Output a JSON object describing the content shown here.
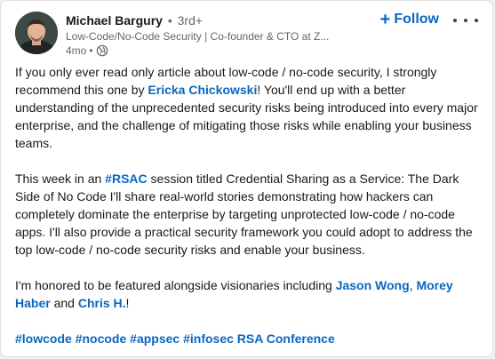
{
  "post": {
    "author": {
      "name": "Michael Bargury",
      "separator": "•",
      "degree": "3rd+",
      "headline": "Low-Code/No-Code Security | Co-founder & CTO at Z...",
      "age": "4mo",
      "meta_dot": "•"
    },
    "follow_label": "Follow",
    "follow_plus": "+",
    "paragraph1": {
      "t1": "If you only ever read only article about low-code / no-code security, I strongly recommend this one by ",
      "mention": "Ericka Chickowski",
      "t2": "! You'll end up with a better understanding of the unprecedented security risks being introduced into every major enterprise, and the challenge of mitigating those risks while enabling your business teams."
    },
    "paragraph2": {
      "t1": "This week in an ",
      "hashtag": "#RSAC",
      "t2": " session titled Credential Sharing as a Service: The Dark Side of No Code I'll share real-world stories demonstrating how hackers can completely dominate the enterprise by targeting unprotected low-code / no-code apps. I'll also provide a practical security framework you could adopt to address the top low-code / no-code security risks and enable your business."
    },
    "paragraph3": {
      "t1": "I'm honored to be featured alongside visionaries including ",
      "mention1": "Jason Wong",
      "comma": ", ",
      "mention2": "Morey Haber",
      "and": " and ",
      "mention3": "Chris H.",
      "end": "!"
    },
    "tags": {
      "lowcode": "#lowcode",
      "nocode": "#nocode",
      "appsec": "#appsec",
      "infosec": "#infosec",
      "rsa": "RSA Conference"
    },
    "colors": {
      "link": "#0a66c2",
      "text": "#191919",
      "muted": "#666666"
    },
    "icons": {
      "visibility": "globe-icon",
      "more": "ellipsis-icon",
      "follow": "plus-icon"
    }
  }
}
